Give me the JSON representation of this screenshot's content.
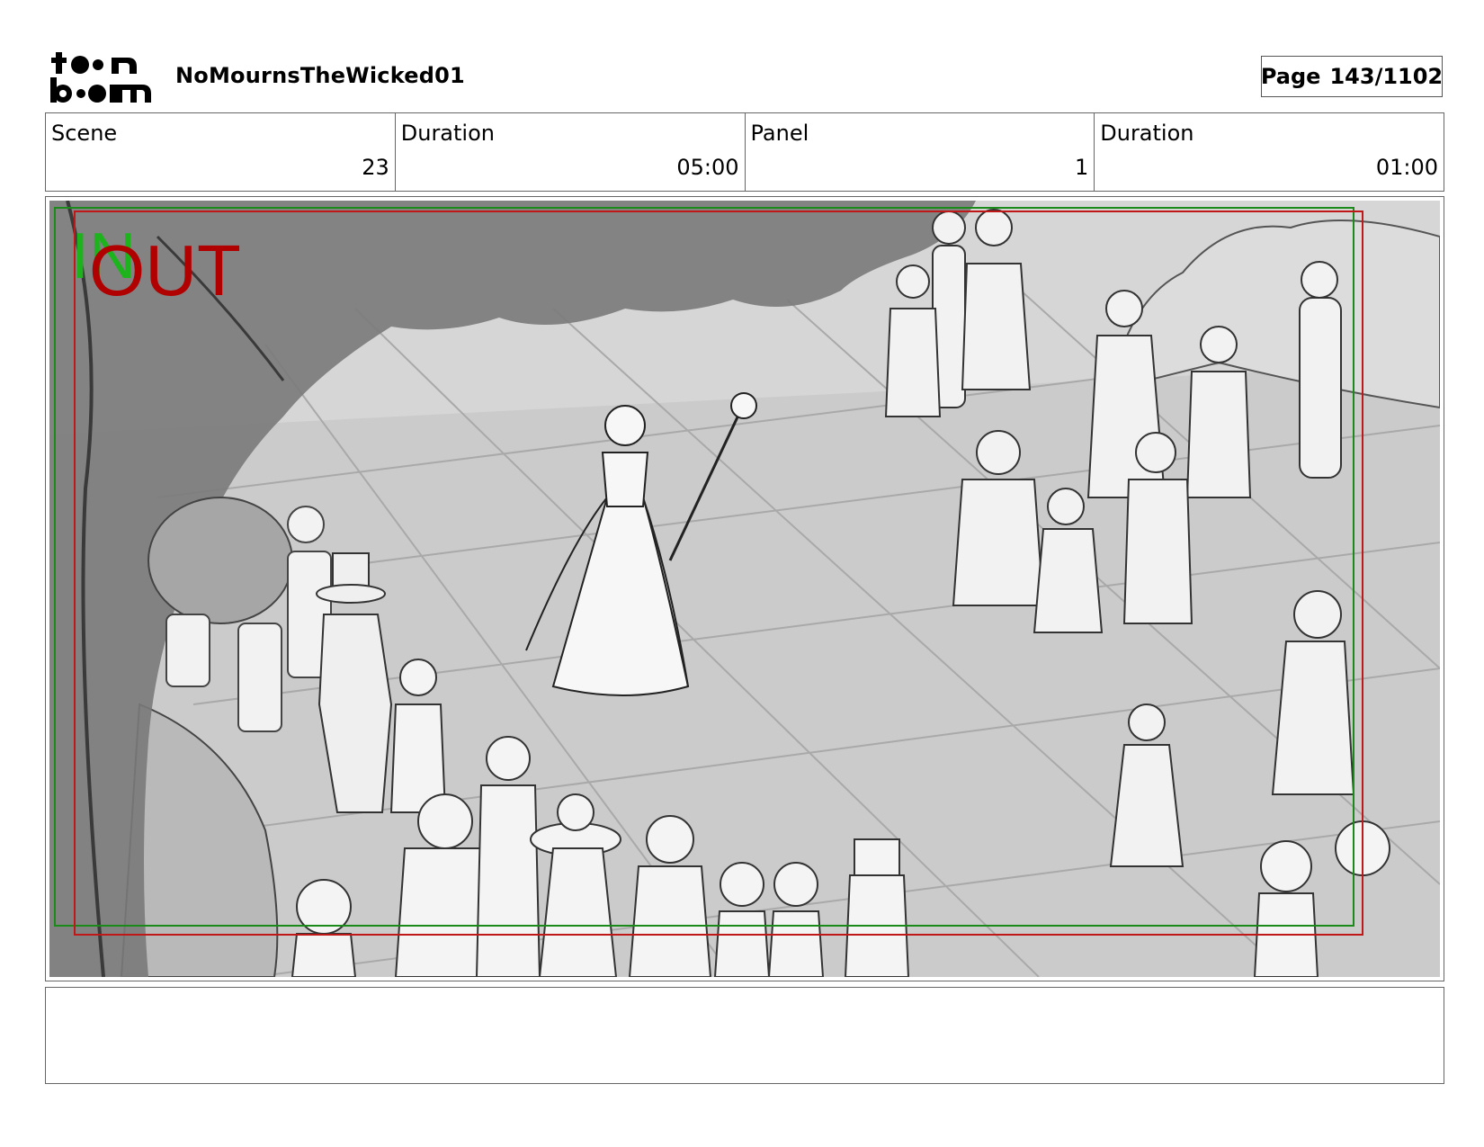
{
  "logo": {
    "line1": "toon",
    "line2": "boom"
  },
  "project": {
    "title": "NoMournsTheWicked01"
  },
  "page": {
    "label": "Page",
    "value": "143/1102"
  },
  "info": {
    "scene_label": "Scene",
    "scene_value": "23",
    "scene_duration_label": "Duration",
    "scene_duration_value": "05:00",
    "panel_label": "Panel",
    "panel_value": "1",
    "panel_duration_label": "Duration",
    "panel_duration_value": "01:00"
  },
  "panel": {
    "guide_in": "IN",
    "guide_out": "OUT",
    "colors": {
      "in_frame": "#1a8a1a",
      "out_frame": "#c01818",
      "floor": "#c9c9c9",
      "tree": "#7a7a7a"
    }
  },
  "notes": {
    "text": ""
  }
}
